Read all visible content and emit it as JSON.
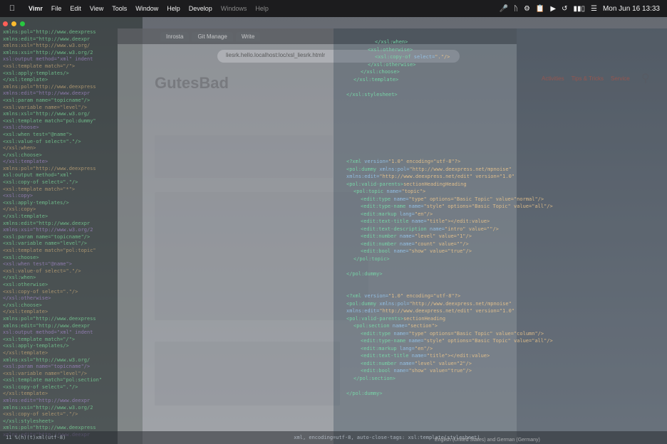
{
  "menubar": {
    "app_name": "Vimr",
    "items": [
      "File",
      "Edit",
      "View",
      "Tools",
      "Window",
      "Help",
      "Develop"
    ],
    "ghost_items": [
      "Windows",
      "Help"
    ],
    "status_icons": [
      "mic-icon",
      "bluetooth-icon",
      "tools-icon",
      "paste-icon",
      "play-icon",
      "time-machine-icon",
      "battery-icon",
      "control-center-icon"
    ],
    "clock": "Mon Jun 16  13:33"
  },
  "browser": {
    "tabs": [
      "Inrosta",
      "Git Manage",
      "Write"
    ],
    "url": "liesrk.hello.localhost:loc/xsl_liesrk.htmlr",
    "brand": "GutesBad",
    "nav": [
      "Activities",
      "Tips & Tricks",
      "Service"
    ]
  },
  "editor": {
    "lines": [
      {
        "indent": 5,
        "tag": "</xsl:when>",
        "attr": "",
        "str": ""
      },
      {
        "indent": 4,
        "tag": "<xsl:otherwise>",
        "attr": "",
        "str": ""
      },
      {
        "indent": 5,
        "tag": "<xsl:copy-of",
        "attr": " select=",
        "str": "\".\"/>"
      },
      {
        "indent": 4,
        "tag": "</xsl:otherwise>",
        "attr": "",
        "str": ""
      },
      {
        "indent": 3,
        "tag": "</xsl:choose>",
        "attr": "",
        "str": ""
      },
      {
        "indent": 2,
        "tag": "</xsl:template>",
        "attr": "",
        "str": ""
      },
      {
        "indent": 0,
        "tag": "",
        "attr": "",
        "str": ""
      },
      {
        "indent": 1,
        "tag": "</xsl:stylesheet>",
        "attr": "",
        "str": ""
      },
      {
        "indent": 0,
        "tag": "",
        "attr": "",
        "str": ""
      },
      {
        "indent": 0,
        "tag": "",
        "attr": "",
        "str": ""
      },
      {
        "indent": 0,
        "tag": "",
        "attr": "",
        "str": ""
      },
      {
        "indent": 0,
        "tag": "",
        "attr": "",
        "str": ""
      },
      {
        "indent": 0,
        "tag": "",
        "attr": "",
        "str": ""
      },
      {
        "indent": 0,
        "tag": "",
        "attr": "",
        "str": ""
      },
      {
        "indent": 0,
        "tag": "",
        "attr": "",
        "str": ""
      },
      {
        "indent": 0,
        "tag": "",
        "attr": "",
        "str": ""
      },
      {
        "indent": 1,
        "tag": "<?xml",
        "attr": " version=",
        "str": "\"1.0\" encoding=\"utf-8\"?>"
      },
      {
        "indent": 1,
        "tag": "<pol:dummy",
        "attr": " xmlns:pol=",
        "str": "\"http://www.deexpress.net/mpnoise\""
      },
      {
        "indent": 1,
        "tag": "",
        "attr": "  xmlns:edit=",
        "str": "\"http://www.deexpress.net/edit\" version=\"1.0\""
      },
      {
        "indent": 1,
        "tag": "<pol:valid-parents>",
        "attr": "",
        "str": "sectionHeadingHeading"
      },
      {
        "indent": 2,
        "tag": "<pol:topic",
        "attr": " name=",
        "str": "\"topic\">"
      },
      {
        "indent": 3,
        "tag": "<edit:type",
        "attr": " name=",
        "str": "\"type\" options=\"Basic Topic\" value=\"normal\"/>"
      },
      {
        "indent": 3,
        "tag": "<edit:type-name",
        "attr": " name=",
        "str": "\"style\" options=\"Basic Topic\" value=\"all\"/>"
      },
      {
        "indent": 3,
        "tag": "<edit:markup",
        "attr": " lang=",
        "str": "\"en\"/>"
      },
      {
        "indent": 3,
        "tag": "<edit:text-title",
        "attr": " name=",
        "str": "\"title\"></edit:value>"
      },
      {
        "indent": 3,
        "tag": "<edit:text-description",
        "attr": " name=",
        "str": "\"intro\" value=\"\"/>"
      },
      {
        "indent": 3,
        "tag": "<edit:number",
        "attr": " name=",
        "str": "\"level\" value=\"1\"/>"
      },
      {
        "indent": 3,
        "tag": "<edit:number",
        "attr": " name=",
        "str": "\"count\" value=\"\"/>"
      },
      {
        "indent": 3,
        "tag": "<edit:bool",
        "attr": " name=",
        "str": "\"show\" value=\"true\"/>"
      },
      {
        "indent": 2,
        "tag": "</pol:topic>",
        "attr": "",
        "str": ""
      },
      {
        "indent": 0,
        "tag": "",
        "attr": "",
        "str": ""
      },
      {
        "indent": 1,
        "tag": "</pol:dummy>",
        "attr": "",
        "str": ""
      },
      {
        "indent": 0,
        "tag": "",
        "attr": "",
        "str": ""
      },
      {
        "indent": 0,
        "tag": "",
        "attr": "",
        "str": ""
      },
      {
        "indent": 1,
        "tag": "<?xml",
        "attr": " version=",
        "str": "\"1.0\" encoding=\"utf-8\"?>"
      },
      {
        "indent": 1,
        "tag": "<pol:dummy",
        "attr": " xmlns:pol=",
        "str": "\"http://www.deexpress.net/mpnoise\""
      },
      {
        "indent": 1,
        "tag": "",
        "attr": "  xmlns:edit=",
        "str": "\"http://www.deexpress.net/edit\" version=\"1.0\""
      },
      {
        "indent": 1,
        "tag": "<pol:valid-parents>",
        "attr": "",
        "str": "sectionHeading"
      },
      {
        "indent": 2,
        "tag": "<pol:section",
        "attr": " name=",
        "str": "\"section\">"
      },
      {
        "indent": 3,
        "tag": "<edit:type",
        "attr": " name=",
        "str": "\"type\" options=\"Basic Topic\" value=\"column\"/>"
      },
      {
        "indent": 3,
        "tag": "<edit:type-name",
        "attr": " name=",
        "str": "\"style\" options=\"Basic Topic\" value=\"all\"/>"
      },
      {
        "indent": 3,
        "tag": "<edit:markup",
        "attr": " lang=",
        "str": "\"en\"/>"
      },
      {
        "indent": 3,
        "tag": "<edit:text-title",
        "attr": " name=",
        "str": "\"title\"></edit:value>"
      },
      {
        "indent": 3,
        "tag": "<edit:number",
        "attr": " name=",
        "str": "\"level\" value=\"2\"/>"
      },
      {
        "indent": 3,
        "tag": "<edit:bool",
        "attr": " name=",
        "str": "\"show\" value=\"true\"/>"
      },
      {
        "indent": 2,
        "tag": "</pol:section>",
        "attr": "",
        "str": ""
      },
      {
        "indent": 0,
        "tag": "",
        "attr": "",
        "str": ""
      },
      {
        "indent": 1,
        "tag": "</pol:dummy>",
        "attr": "",
        "str": ""
      }
    ]
  },
  "terminal": {
    "lines": [
      "xmlns:pol=\"http://www.deexpress",
      "xmlns:edit=\"http://www.deexpr",
      "xmlns:xsl=\"http://www.w3.org/",
      "xmlns:xsi=\"http://www.w3.org/2",
      "xsl:output method=\"xml\" indent",
      "<xsl:template match=\"/\">",
      "  <xsl:apply-templates/>",
      "</xsl:template>",
      "xmlns:pol=\"http://www.deexpress",
      "xmlns:edit=\"http://www.deexpr",
      "<xsl:param name=\"topicname\"/>",
      "<xsl:variable name=\"level\"/>",
      "xmlns:xsl=\"http://www.w3.org/",
      "<xsl:template match=\"pol:dummy\"",
      "  <xsl:choose>",
      "    <xsl:when test=\"@name\">",
      "      <xsl:value-of select=\".\"/>",
      "    </xsl:when>",
      "  </xsl:choose>",
      "</xsl:template>",
      "xmlns:pol=\"http://www.deexpress",
      "xsl:output method=\"xml\"",
      "<xsl:copy-of select=\".\"/>",
      "<xsl:template match=\"*\">",
      "  <xsl:copy>",
      "    <xsl:apply-templates/>",
      "  </xsl:copy>",
      "</xsl:template>",
      "xmlns:edit=\"http://www.deexpr",
      "xmlns:xsi=\"http://www.w3.org/2",
      "<xsl:param name=\"topicname\"/>",
      "<xsl:variable name=\"level\"/>",
      "<xsl:template match=\"pol:topic\"",
      "  <xsl:choose>",
      "    <xsl:when test=\"@name\">",
      "      <xsl:value-of select=\".\"/>",
      "    </xsl:when>",
      "    <xsl:otherwise>",
      "      <xsl:copy-of select=\".\"/>",
      "    </xsl:otherwise>",
      "  </xsl:choose>",
      "</xsl:template>",
      "xmlns:pol=\"http://www.deexpress",
      "xmlns:edit=\"http://www.deexpr",
      "xsl:output method=\"xml\" indent",
      "<xsl:template match=\"/\">",
      "  <xsl:apply-templates/>",
      "</xsl:template>",
      "xmlns:xsl=\"http://www.w3.org/",
      "<xsl:param name=\"topicname\"/>",
      "<xsl:variable name=\"level\"/>",
      "<xsl:template match=\"pol:section\"",
      "  <xsl:copy-of select=\".\"/>",
      "</xsl:template>",
      "xmlns:edit=\"http://www.deexpr",
      "xmlns:xsi=\"http://www.w3.org/2",
      "<xsl:copy-of select=\".\"/>",
      "</xsl:stylesheet>",
      "xmlns:pol=\"http://www.deexpress",
      "xmlns:edit=\"http://www.deexpr"
    ]
  },
  "statusbar": {
    "left": "11 %(h)(t)xml(utf-8)",
    "middle": "xml, encoding=utf-8, auto-close-tags: xsl:template(stylesheet)",
    "language": "English (United States) and German (Germany)"
  },
  "colors": {
    "menubar_bg": "#1c1c1e",
    "tl_close": "#ff5f57",
    "tl_min": "#febc2e",
    "tl_max": "#28c840"
  }
}
